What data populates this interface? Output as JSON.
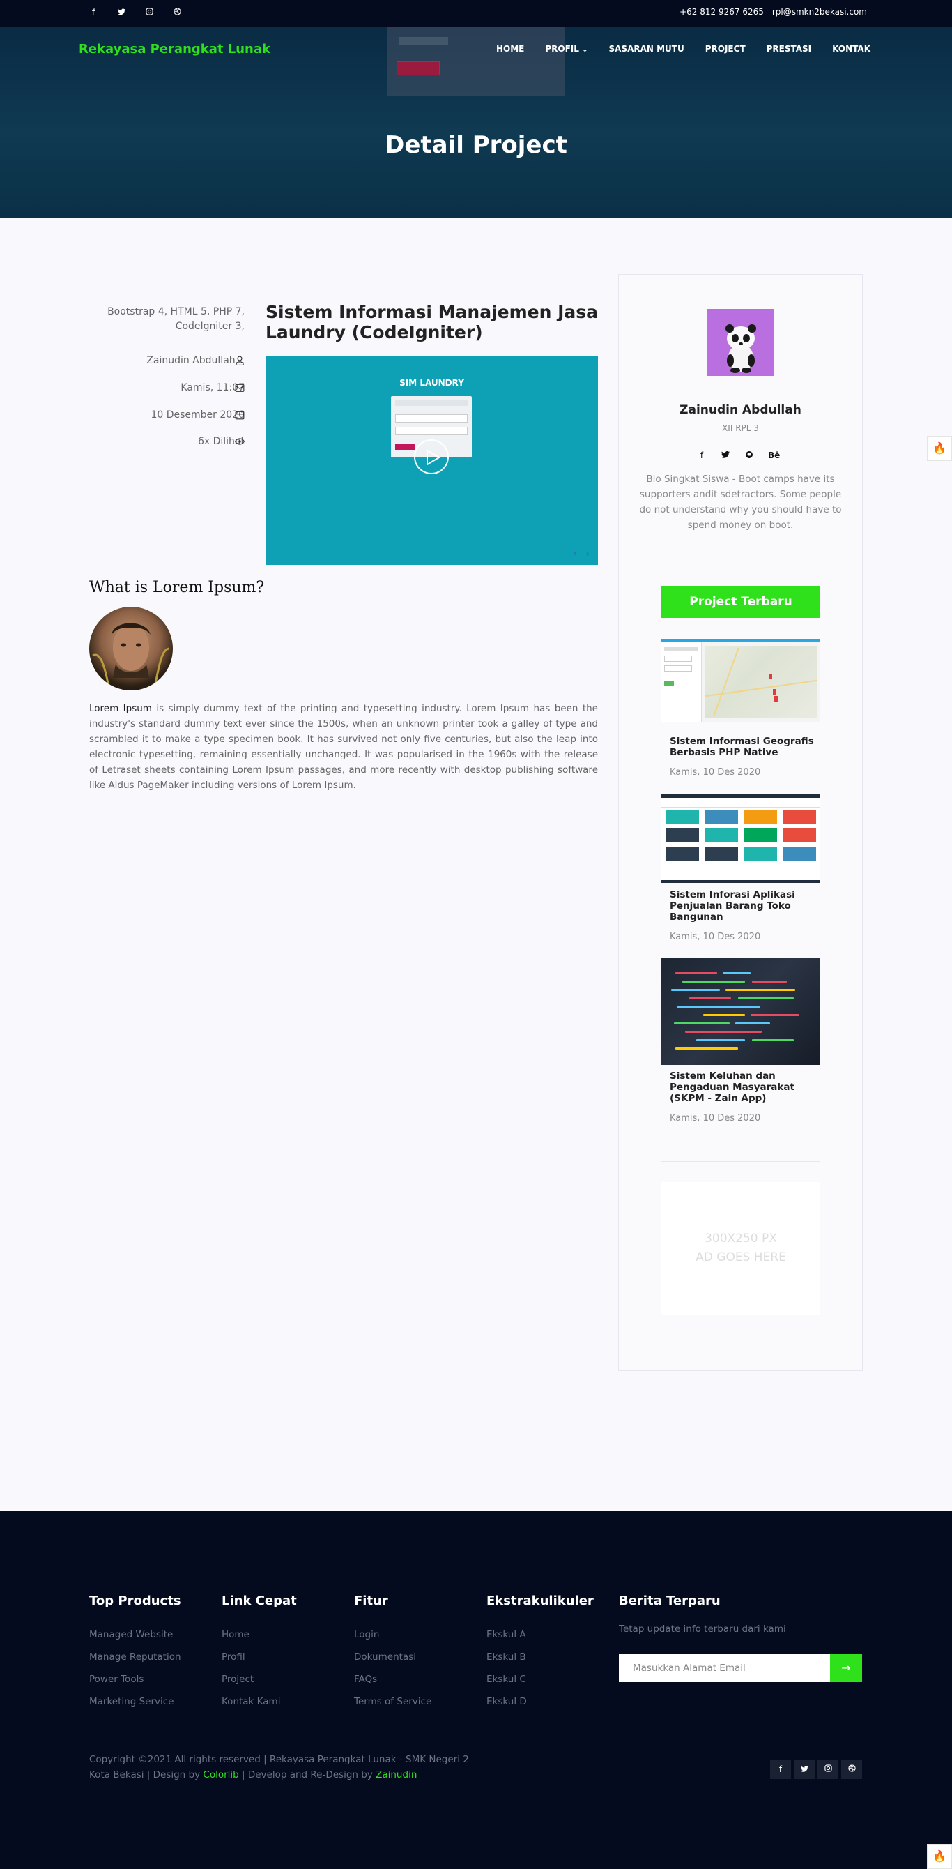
{
  "topbar": {
    "social_icons": [
      "facebook-icon",
      "twitter-icon",
      "instagram-icon",
      "dribbble-icon"
    ],
    "phone": "+62 812 9267 6265",
    "email": "rpl@smkn2bekasi.com"
  },
  "header": {
    "brand": "Rekayasa Perangkat Lunak",
    "nav": [
      "HOME",
      "PROFIL",
      "SASARAN MUTU",
      "PROJECT",
      "PRESTASI",
      "KONTAK"
    ],
    "page_title": "Detail Project"
  },
  "project": {
    "tech": "Bootstrap 4, HTML 5, PHP 7, CodeIgniter 3,",
    "author": "Zainudin Abdullah...",
    "day_time": "Kamis, 11:07",
    "date": "10 Desember 2020",
    "views": "6x Dilihat",
    "title": "Sistem Informasi Manajemen Jasa Laundry (CodeIgniter)",
    "video": {
      "app_name": "SIM LAUNDRY",
      "arrows": "‹ ›"
    }
  },
  "article": {
    "heading": "What is Lorem Ipsum?",
    "lead": "Lorem Ipsum",
    "body": " is simply dummy text of the printing and typesetting industry. Lorem Ipsum has been the industry's standard dummy text ever since the 1500s, when an unknown printer took a galley of type and scrambled it to make a type specimen book. It has survived not only five centuries, but also the leap into electronic typesetting, remaining essentially unchanged. It was popularised in the 1960s with the release of Letraset sheets containing Lorem Ipsum passages, and more recently with desktop publishing software like Aldus PageMaker including versions of Lorem Ipsum."
  },
  "sidebar": {
    "name": "Zainudin Abdullah",
    "class": "XII RPL 3",
    "social_icons": [
      "facebook-icon",
      "twitter-icon",
      "github-icon",
      "behance-icon"
    ],
    "behance_label": "Bē",
    "bio": "Bio Singkat Siswa - Boot camps have its supporters andit sdetractors. Some people do not understand why you should have to spend money on boot.",
    "latest_button": "Project Terbaru",
    "projects": [
      {
        "title": "Sistem Informasi Geografis Berbasis PHP Native",
        "date": "Kamis, 10 Des 2020"
      },
      {
        "title": "Sistem Inforasi Aplikasi Penjualan Barang Toko Bangunan",
        "date": "Kamis, 10 Des 2020"
      },
      {
        "title": "Sistem Keluhan dan Pengaduan Masyarakat (SKPM - Zain App)",
        "date": "Kamis, 10 Des 2020"
      }
    ],
    "ad_line1": "300X250 PX",
    "ad_line2": "AD GOES HERE"
  },
  "footer": {
    "columns": [
      {
        "title": "Top Products",
        "items": [
          "Managed Website",
          "Manage Reputation",
          "Power Tools",
          "Marketing Service"
        ]
      },
      {
        "title": "Link Cepat",
        "items": [
          "Home",
          "Profil",
          "Project",
          "Kontak Kami"
        ]
      },
      {
        "title": "Fitur",
        "items": [
          "Login",
          "Dokumentasi",
          "FAQs",
          "Terms of Service"
        ]
      },
      {
        "title": "Ekstrakulikuler",
        "items": [
          "Ekskul A",
          "Ekskul B",
          "Ekskul C",
          "Ekskul D"
        ]
      }
    ],
    "newsletter": {
      "title": "Berita Terparu",
      "text": "Tetap update info terbaru dari kami",
      "placeholder": "Masukkan Alamat Email"
    },
    "copyright_1": "Copyright ©2021 All rights reserved | Rekayasa Perangkat Lunak - SMK Negeri 2 Kota Bekasi | Design by ",
    "colorlib": "Colorlib",
    "copyright_2": " | Develop and Re-Design by ",
    "zainudin": "Zainudin",
    "social_icons": [
      "facebook-icon",
      "twitter-icon",
      "instagram-icon",
      "dribbble-icon"
    ]
  },
  "colors": {
    "accent": "#2fe11a",
    "topbar": "#040b1f",
    "hero": "#0f3a52",
    "footer": "#040b1f"
  }
}
